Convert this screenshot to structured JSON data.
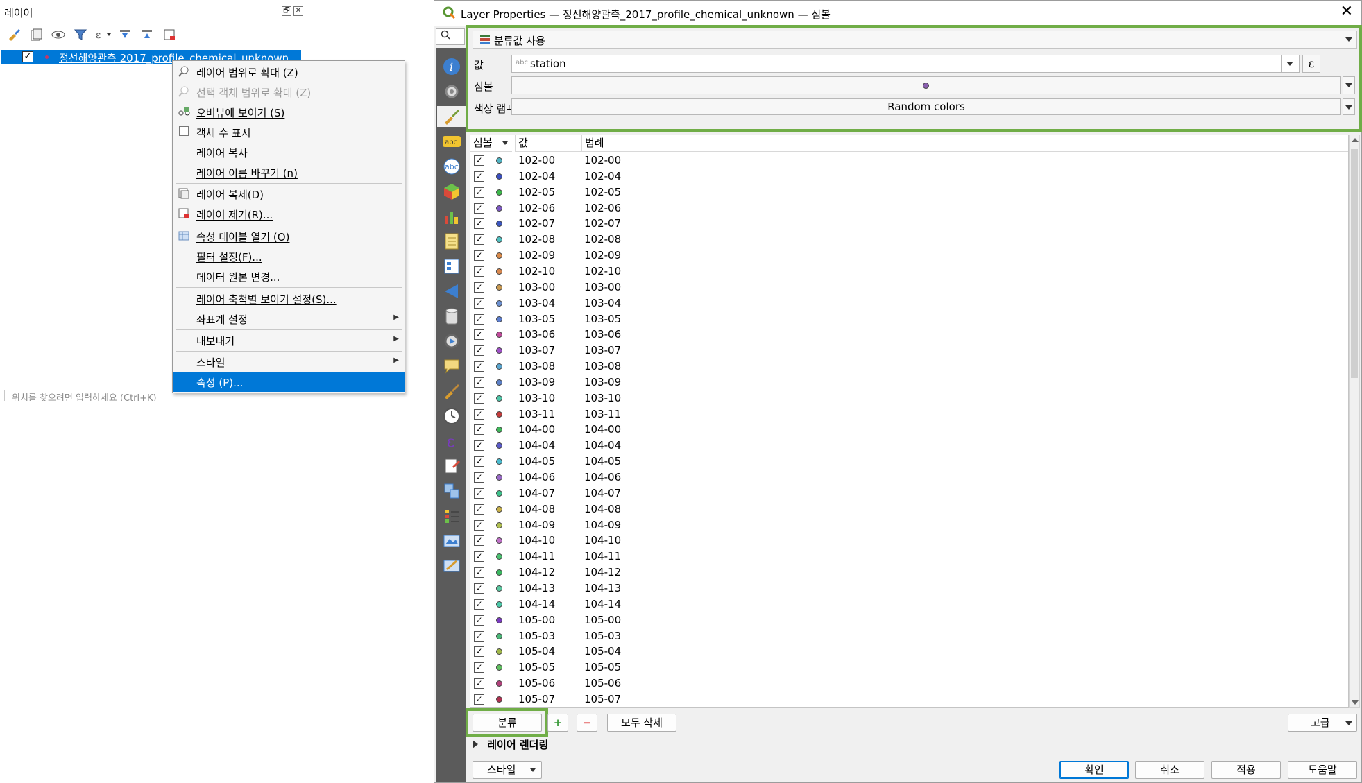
{
  "layers_panel": {
    "title": "레이어",
    "dock_buttons": [
      "🗗",
      "✕"
    ],
    "toolbar_icons": [
      "style-brush-icon",
      "add-group-icon",
      "eye-icon",
      "filter-icon",
      "expression-filter-icon",
      "expand-all-icon",
      "collapse-all-icon",
      "remove-layer-icon"
    ],
    "layer": {
      "name": "정선해양관측 2017_profile_chemical_unknown",
      "checked": "✓"
    },
    "locator_placeholder": "위치를 찾으려면 입력하세요 (Ctrl+K)"
  },
  "context_menu": {
    "items": [
      {
        "label": "레이어 범위로 확대 (Z)",
        "icon": "zoom-layer-icon"
      },
      {
        "label": "선택 객체 범위로 확대 (Z)",
        "icon": "zoom-selection-icon",
        "disabled": true
      },
      {
        "label": "오버뷰에 보이기 (S)",
        "icon": "overview-icon"
      },
      {
        "label": "객체 수 표시",
        "icon": "checkbox-icon"
      },
      {
        "label": "레이어 복사"
      },
      {
        "label": "레이어 이름 바꾸기 (n)"
      },
      {
        "label": "레이어 복제(D)",
        "icon": "duplicate-layer-icon"
      },
      {
        "label": "레이어 제거(R)...",
        "icon": "remove-layer-icon"
      },
      {
        "label": "속성 테이블 열기 (O)",
        "icon": "attribute-table-icon"
      },
      {
        "label": "필터 설정(F)..."
      },
      {
        "label": "데이터 원본 변경..."
      },
      {
        "label": "레이어 축척별 보이기 설정(S)..."
      },
      {
        "label": "좌표계 설정",
        "submenu": true
      },
      {
        "label": "내보내기",
        "submenu": true
      },
      {
        "label": "스타일",
        "submenu": true
      },
      {
        "label": "속성 (P)...",
        "selected": true
      }
    ]
  },
  "dialog": {
    "title": "Layer Properties — 정선해양관측_2017_profile_chemical_unknown — 심볼",
    "search_placeholder": "",
    "renderer": "분류값 사용",
    "value_label": "값",
    "value_field": "station",
    "value_field_type": "abc",
    "symbol_label": "심볼",
    "color_ramp_label": "색상 램프",
    "color_ramp": "Random colors",
    "expression_icon": "ε",
    "columns": {
      "symbol": "심볼",
      "value": "값",
      "legend": "범례"
    },
    "classes": [
      {
        "value": "102-00",
        "legend": "102-00",
        "color": "#4fb4c4"
      },
      {
        "value": "102-04",
        "legend": "102-04",
        "color": "#3a4fc0"
      },
      {
        "value": "102-05",
        "legend": "102-05",
        "color": "#3cb84a"
      },
      {
        "value": "102-06",
        "legend": "102-06",
        "color": "#7d58c4"
      },
      {
        "value": "102-07",
        "legend": "102-07",
        "color": "#3b56c0"
      },
      {
        "value": "102-08",
        "legend": "102-08",
        "color": "#4fc0c0"
      },
      {
        "value": "102-09",
        "legend": "102-09",
        "color": "#d98a4a"
      },
      {
        "value": "102-10",
        "legend": "102-10",
        "color": "#d9884e"
      },
      {
        "value": "103-00",
        "legend": "103-00",
        "color": "#c99a52"
      },
      {
        "value": "103-04",
        "legend": "103-04",
        "color": "#6a8fd0"
      },
      {
        "value": "103-05",
        "legend": "103-05",
        "color": "#5c7ed0"
      },
      {
        "value": "103-06",
        "legend": "103-06",
        "color": "#c04a9a"
      },
      {
        "value": "103-07",
        "legend": "103-07",
        "color": "#a050c8"
      },
      {
        "value": "103-08",
        "legend": "103-08",
        "color": "#5aa6d0"
      },
      {
        "value": "103-09",
        "legend": "103-09",
        "color": "#5c80c8"
      },
      {
        "value": "103-10",
        "legend": "103-10",
        "color": "#4ec6a8"
      },
      {
        "value": "103-11",
        "legend": "103-11",
        "color": "#c43a3a"
      },
      {
        "value": "104-00",
        "legend": "104-00",
        "color": "#3fb85a"
      },
      {
        "value": "104-04",
        "legend": "104-04",
        "color": "#5a5ac8"
      },
      {
        "value": "104-05",
        "legend": "104-05",
        "color": "#4abcd0"
      },
      {
        "value": "104-06",
        "legend": "104-06",
        "color": "#9a6ac8"
      },
      {
        "value": "104-07",
        "legend": "104-07",
        "color": "#3cc08a"
      },
      {
        "value": "104-08",
        "legend": "104-08",
        "color": "#c8b048"
      },
      {
        "value": "104-09",
        "legend": "104-09",
        "color": "#b0c050"
      },
      {
        "value": "104-10",
        "legend": "104-10",
        "color": "#c070c8"
      },
      {
        "value": "104-11",
        "legend": "104-11",
        "color": "#4ac070"
      },
      {
        "value": "104-12",
        "legend": "104-12",
        "color": "#3ab860"
      },
      {
        "value": "104-13",
        "legend": "104-13",
        "color": "#5ac8a0"
      },
      {
        "value": "104-14",
        "legend": "104-14",
        "color": "#4ac8a8"
      },
      {
        "value": "105-00",
        "legend": "105-00",
        "color": "#7a3ac0"
      },
      {
        "value": "105-03",
        "legend": "105-03",
        "color": "#4ab878"
      },
      {
        "value": "105-04",
        "legend": "105-04",
        "color": "#a0b848"
      },
      {
        "value": "105-05",
        "legend": "105-05",
        "color": "#60c060"
      },
      {
        "value": "105-06",
        "legend": "105-06",
        "color": "#b0407a"
      },
      {
        "value": "105-07",
        "legend": "105-07",
        "color": "#b03050"
      }
    ],
    "buttons": {
      "classify": "분류",
      "add": "+",
      "remove": "−",
      "delete_all": "모두 삭제",
      "advanced": "고급"
    },
    "layer_rendering": "레이어 렌더링",
    "style_button": "스타일",
    "footer": {
      "ok": "확인",
      "cancel": "취소",
      "apply": "적용",
      "help": "도움말"
    },
    "side_icons": [
      "information-icon",
      "source-icon",
      "symbology-icon",
      "labels-icon",
      "masks-icon",
      "3d-view-icon",
      "diagrams-icon",
      "fields-icon",
      "attributes-form-icon",
      "joins-icon",
      "auxiliary-storage-icon",
      "actions-icon",
      "display-icon",
      "rendering-icon",
      "temporal-icon",
      "variables-icon",
      "metadata-icon",
      "dependencies-icon",
      "legend-icon",
      "qgis-server-icon",
      "digitizing-icon"
    ]
  },
  "colors": {
    "highlight": "#0078d7",
    "green_annotation": "#70ad47",
    "sidebar": "#5b5b5b"
  }
}
